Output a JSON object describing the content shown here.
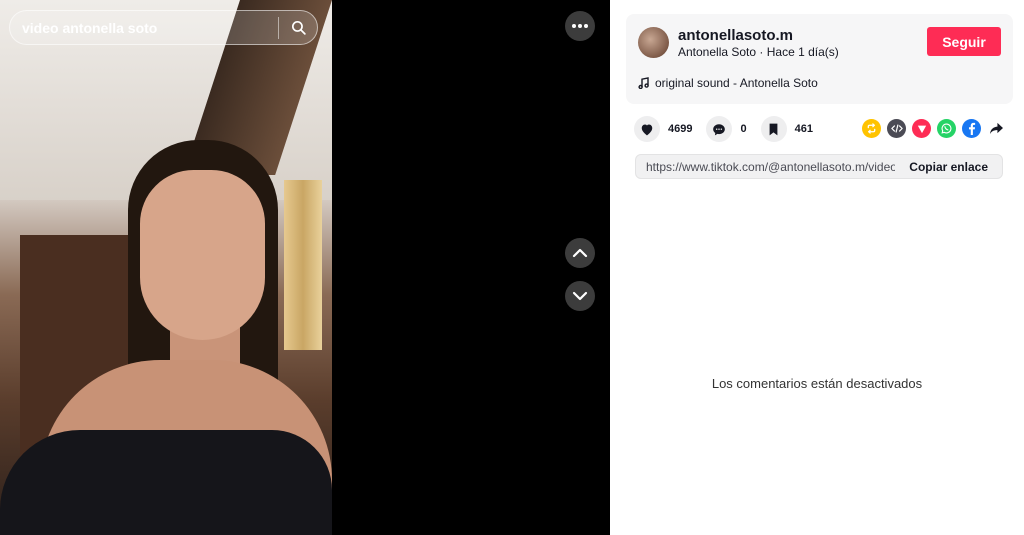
{
  "search": {
    "query": "video antonella soto"
  },
  "author": {
    "username": "antonellasoto.m",
    "display_name": "Antonella Soto",
    "separator": " · ",
    "posted": "Hace 1 día(s)",
    "follow_label": "Seguir"
  },
  "sound": {
    "label": "original sound - Antonella Soto"
  },
  "stats": {
    "likes": "4699",
    "comments": "0",
    "saves": "461"
  },
  "share": {
    "url": "https://www.tiktok.com/@antonellasoto.m/video/7...",
    "copy_label": "Copiar enlace",
    "icons": [
      "repost-icon",
      "embed-icon",
      "send-icon",
      "whatsapp-icon",
      "facebook-icon",
      "share-arrow-icon"
    ]
  },
  "comments": {
    "disabled_message": "Los comentarios están desactivados"
  },
  "colors": {
    "accent": "#fe2c55",
    "repost": "#ffc300",
    "embed": "#4b4b55",
    "send": "#fe2c55",
    "whatsapp": "#25d366",
    "facebook": "#1877f2"
  }
}
